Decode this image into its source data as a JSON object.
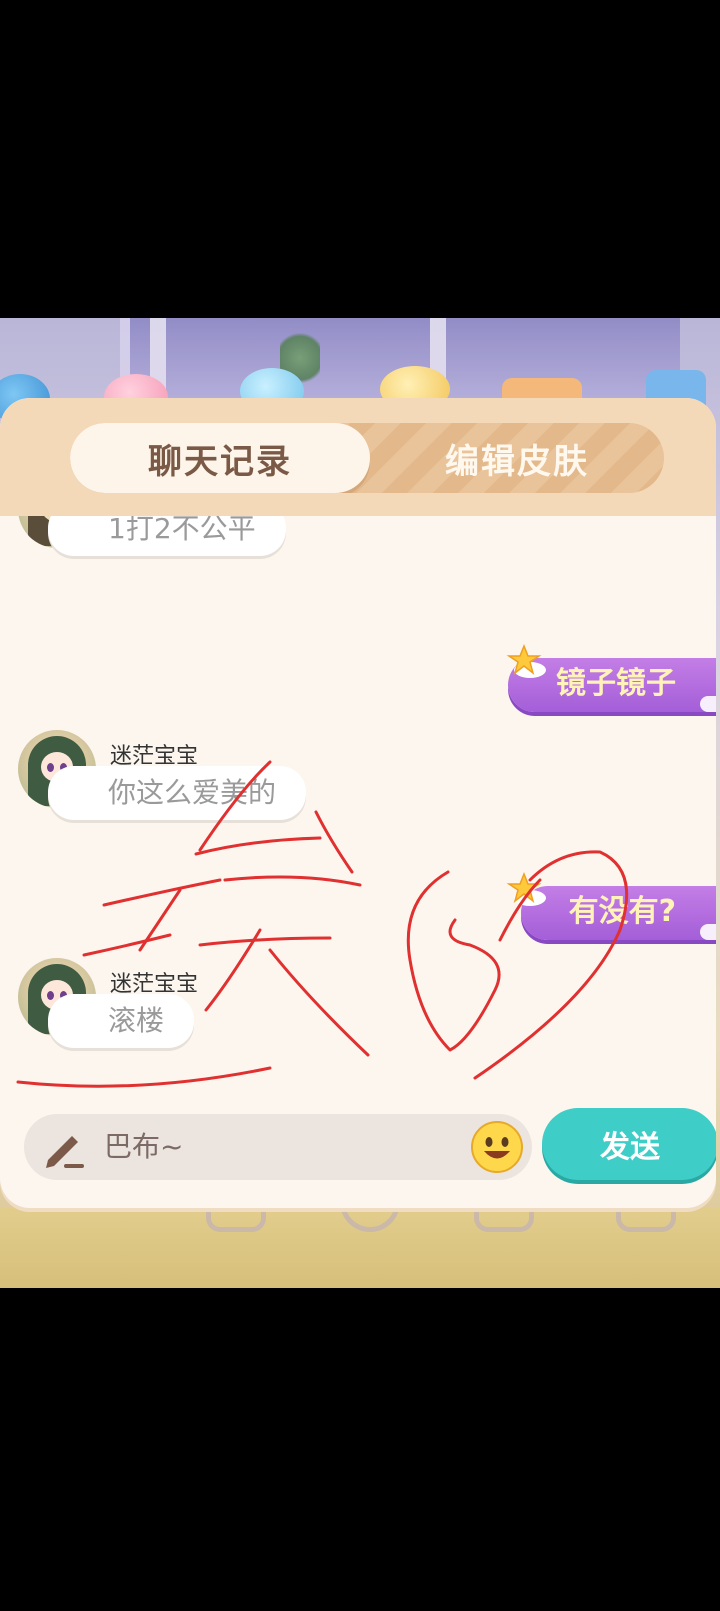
{
  "tabs": {
    "chat_history": "聊天记录",
    "edit_skin": "编辑皮肤"
  },
  "messages": [
    {
      "side": "left",
      "sender": "",
      "text": "1打2不公平"
    },
    {
      "side": "right",
      "text": "镜子镜子"
    },
    {
      "side": "left",
      "sender": "迷茫宝宝",
      "text": "你这么爱美的"
    },
    {
      "side": "right",
      "text": "有没有?"
    },
    {
      "side": "left",
      "sender": "迷茫宝宝",
      "text": "滚楼"
    }
  ],
  "input": {
    "value": "巴布~",
    "icon": "pencil-icon",
    "emoji_icon": "smiley-icon"
  },
  "send_label": "发送",
  "colors": {
    "tab_active_text": "#7a5a46",
    "send_button": "#3fcdc8",
    "right_bubble": "#b06ae0",
    "right_bubble_text": "#fff3b8",
    "scribble": "#e03030"
  }
}
